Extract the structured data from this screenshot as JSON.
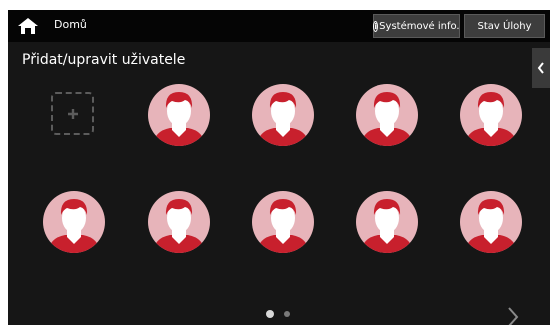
{
  "header": {
    "home_label": "Domů",
    "system_info_label": "Systémové info.",
    "job_status_label": "Stav Úlohy"
  },
  "page": {
    "title": "Přidat/upravit uživatele"
  },
  "users": [
    {
      "id": 1
    },
    {
      "id": 2
    },
    {
      "id": 3
    },
    {
      "id": 4
    },
    {
      "id": 5
    },
    {
      "id": 6
    },
    {
      "id": 7
    },
    {
      "id": 8
    },
    {
      "id": 9
    }
  ],
  "pagination": {
    "current_page": 1,
    "total_pages": 2
  },
  "icons": {
    "home": "home-icon",
    "info": "info-icon",
    "add_user": "plus-icon",
    "user": "user-avatar-icon",
    "side_panel": "chevron-left-icon",
    "next": "chevron-right-icon"
  },
  "colors": {
    "background": "#161616",
    "topbar": "#050505",
    "avatar_circle": "#e7b4ba",
    "avatar_accent": "#c8202d"
  }
}
